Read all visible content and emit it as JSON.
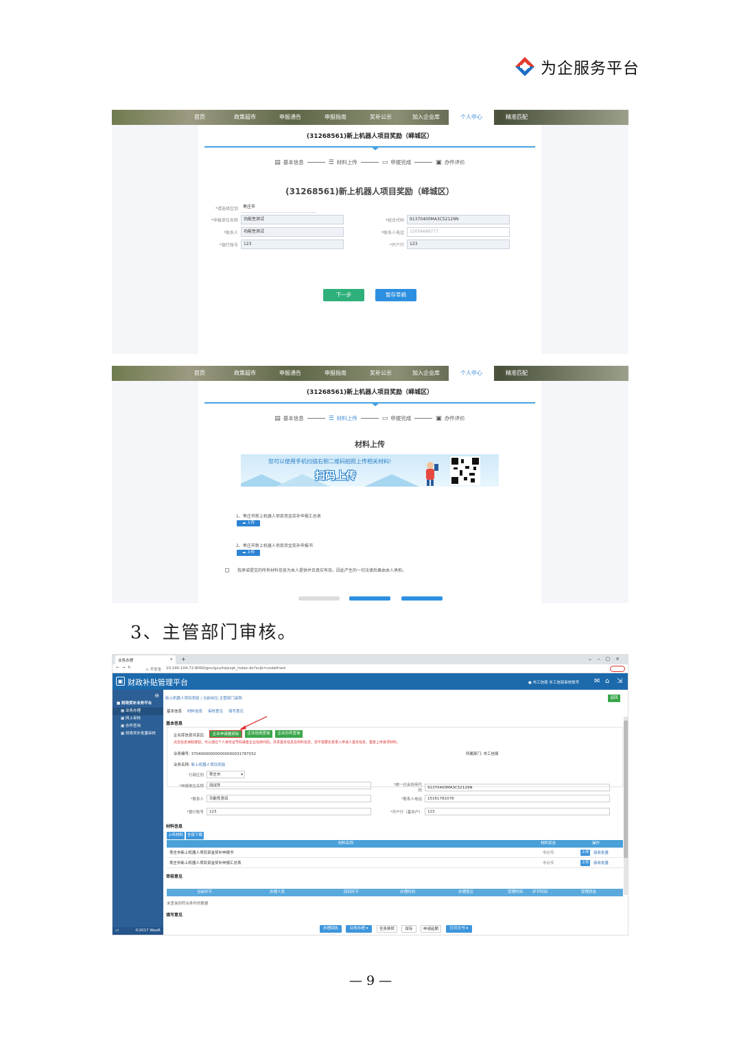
{
  "header": {
    "brand_text": "为企服务平台",
    "logo_icon": "platform-logo-icon"
  },
  "portal": {
    "nav": [
      "首页",
      "政策超市",
      "申报通告",
      "申报指南",
      "奖补公示",
      "加入企业库",
      "个人中心",
      "精准匹配"
    ],
    "active_nav": "个人中心",
    "project_title": "(31268561)新上机器人项目奖励（峄城区）",
    "steps": [
      "基本信息",
      "材料上传",
      "申报完成",
      "办件评价"
    ]
  },
  "shot1": {
    "form_title": "(31268561)新上机器人项目奖励（峄城区）",
    "fields": {
      "region_label": "*请选择区划",
      "region_value": "枣庄市",
      "unit_label": "*申报单位名称",
      "unit_value": "功能性测试",
      "credit_label": "*统合代码",
      "credit_value": "91370400MA3C52129N",
      "contact_label": "*联系人",
      "contact_value": "功能性测试",
      "phone_label": "*联系人电话",
      "phone_value": "15054688777",
      "bank_label": "*银行账号",
      "bank_value": "123",
      "account_label": "*开户行",
      "account_value": "123"
    },
    "next_btn": "下一步",
    "draft_btn": "暂存草稿"
  },
  "shot2": {
    "section_title": "材料上传",
    "banner_line1": "您可以使用手机扫描右侧二维码拍照上传相关材料!",
    "banner_line2": "扫码上传",
    "items": [
      "1、枣庄市新上机器人项目资金奖补申报汇总表",
      "2、枣庄市新上机器人项目资金奖补申报书"
    ],
    "upload_label": "上传",
    "agreement": "我承诺提交的所有材料信息为本人提供并且真实有效，因此产生的一切法律后果由本人承担。"
  },
  "section3_heading": "3、主管部门审核。",
  "shot3": {
    "browser_tab": "业务办理",
    "url": "10.140.104.72:8090/gov/gxu/tqlyxpt_index.do?scjb=undefined",
    "insecure_label": "不安全",
    "app_title": "财政补贴管理平台",
    "user_label": "市工信局 市工信局审核账号",
    "sidebar": [
      "财政奖补业务平台",
      "业务办理",
      "网上审核",
      "办件查询",
      "财政奖补批量审核"
    ],
    "breadcrumb": "新上机器人项目奖励 | 当前岗位:主管部门采购",
    "tabs": [
      "基本信息",
      "材料信息",
      "审核意见",
      "填写意见"
    ],
    "return_btn": "返回",
    "basic_info": "基本信息",
    "share_label": "企业库信息共享区:",
    "share_buttons": [
      "企业申请缴资标",
      "企业信用查询",
      "企业办件查询"
    ],
    "share_note": "点击信息读取按钮，可以通过个人身份证号码或者企业信用代码，共享基本信息及材料信息，您不需要反复录入申请人基本信息，重复上传各项材料。",
    "biz_no_label": "业务编号:",
    "biz_no": "370400000000000000031787032",
    "dept_label": "所属部门:",
    "dept": "市工信局",
    "biz_name_label": "业务名称:",
    "biz_name": "新上机器人项目奖励",
    "district_label": "行政区划",
    "district": "枣庄市",
    "unit_label": "*申报单位名称",
    "unit": "测试件",
    "credit_label": "*统一社会信用代码",
    "credit": "91370400MA3C52129N",
    "contact_label": "*联系人",
    "contact": "功能性测试",
    "phone_label": "*联系人电话",
    "phone": "15161781078",
    "bank_label": "*银行账号",
    "bank": "123",
    "account_label": "*开户行（基本户）",
    "account": "123",
    "materials_label": "材料信息",
    "mat_buttons": [
      "上传材料",
      "全部下载"
    ],
    "mat_cols": [
      "材料名称",
      "材料状态",
      "操作"
    ],
    "mat_rows": [
      {
        "name": "枣庄市新上机器人项目资金奖补申报书",
        "status": "非必传",
        "op1": "上传",
        "op2": "接收批量"
      },
      {
        "name": "枣庄市新上机器人项目资金奖补申报汇总表",
        "status": "非必传",
        "op1": "上传",
        "op2": "接收批量"
      }
    ],
    "review_label": "审核意见",
    "review_cols": [
      "当前环节",
      "办理人员",
      "回到环节",
      "办理时间",
      "办理意见",
      "受理时间",
      "环节时间",
      "受理状态"
    ],
    "review_empty": "未查询到符合条件的数据",
    "fill_label": "填写意见",
    "bottom_buttons": [
      "办理回执",
      "业务办理 ▾",
      "任务移转",
      "保存",
      "申请延期",
      "打印文书 ▾"
    ],
    "footer": "©2017  WooR"
  },
  "page_number": "— 9 —"
}
